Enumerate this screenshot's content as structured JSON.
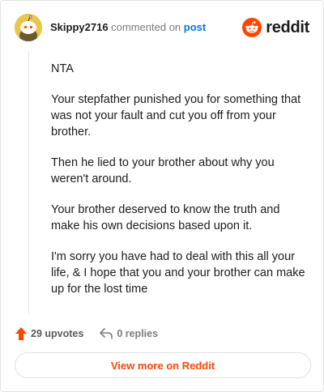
{
  "comment": {
    "username": "Skippy2716",
    "verb": "commented on",
    "target": "post"
  },
  "brand": {
    "wordmark": "reddit",
    "accent": "#ff4500"
  },
  "body": {
    "paragraphs": [
      "NTA",
      "Your stepfather punished you for something that was not your fault and cut you off from your brother.",
      "Then he lied to your brother about why you weren't around.",
      "Your brother deserved to know the truth and make his own decisions based upon it.",
      "I'm sorry you have had to deal with this all your life, & I hope that you and your brother can make up for the lost time"
    ]
  },
  "actions": {
    "upvotes": "29 upvotes",
    "replies": "0 replies",
    "upvote_icon": "upvote-arrow-icon",
    "reply_icon": "reply-arrow-icon"
  },
  "footer": {
    "view_more": "View more on Reddit"
  }
}
